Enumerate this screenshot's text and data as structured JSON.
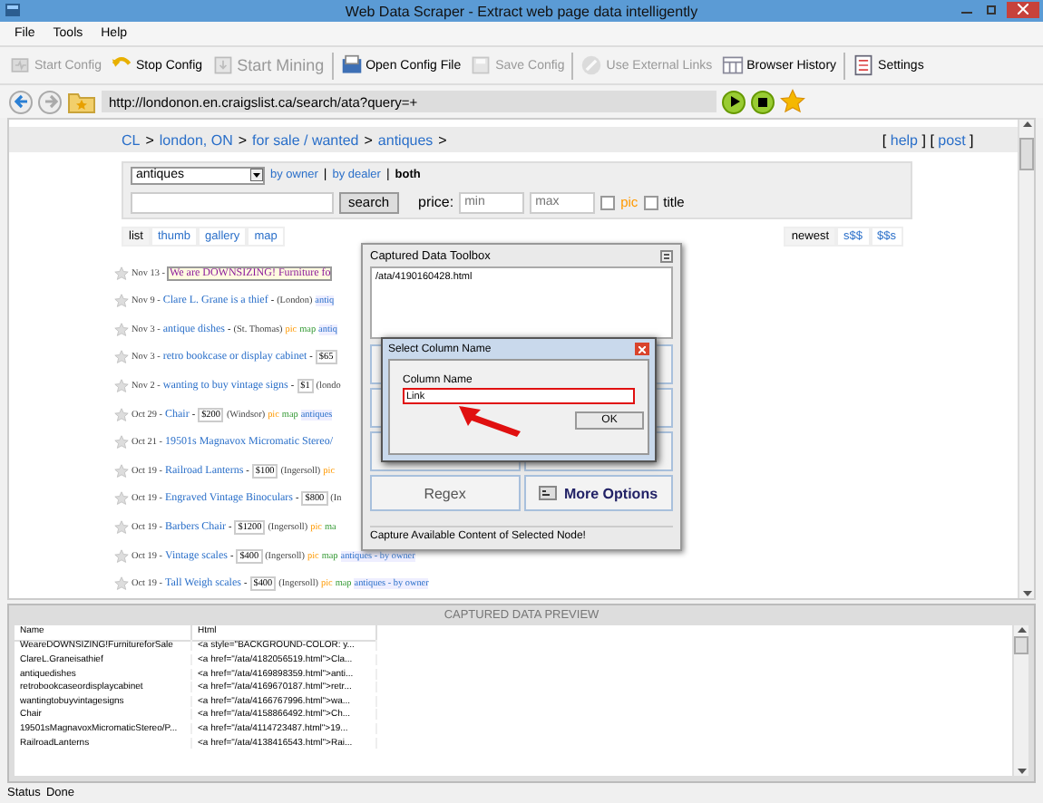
{
  "window": {
    "title": "Web Data Scraper -  Extract web page data intelligently"
  },
  "menu": [
    "File",
    "Tools",
    "Help"
  ],
  "toolbar": [
    {
      "label": "Start Config",
      "disabled": true
    },
    {
      "label": "Stop Config",
      "disabled": false
    },
    {
      "label": "Start Mining",
      "disabled": true
    },
    {
      "label": "Open Config File",
      "disabled": false
    },
    {
      "label": "Save Config",
      "disabled": true
    },
    {
      "label": "Use External Links",
      "disabled": true
    },
    {
      "label": "Browser History",
      "disabled": false
    },
    {
      "label": "Settings",
      "disabled": false
    }
  ],
  "address": {
    "url": "http://londonon.en.craigslist.ca/search/ata?query=+"
  },
  "breadcrumb": {
    "links": [
      "CL",
      "london, ON",
      "for sale / wanted",
      "antiques"
    ],
    "separator": ">",
    "help_links": [
      {
        "before": "[",
        "label": "help",
        "after": "]"
      },
      {
        "before": "[",
        "label": "post",
        "after": "]"
      }
    ]
  },
  "search": {
    "category": "antiques",
    "filters": [
      {
        "label": "by owner",
        "selected": false
      },
      {
        "label": "by dealer",
        "selected": false
      },
      {
        "label": "both",
        "selected": true
      }
    ],
    "filter_separator": "|",
    "button": "search",
    "price_label": "price:",
    "min_placeholder": "min",
    "max_placeholder": "max",
    "checkboxes": [
      {
        "label": "pic",
        "checked": false,
        "color": "#ff9900"
      },
      {
        "label": "title",
        "checked": false,
        "color": "#000000"
      }
    ]
  },
  "view_tabs": [
    {
      "label": "list",
      "selected": true
    },
    {
      "label": "thumb",
      "selected": false
    },
    {
      "label": "gallery",
      "selected": false
    },
    {
      "label": "map",
      "selected": false
    }
  ],
  "sort_tabs": [
    {
      "label": "newest",
      "selected": true
    },
    {
      "label": "s$$",
      "selected": false
    },
    {
      "label": "$$s",
      "selected": false
    }
  ],
  "listings": [
    {
      "highlighted": true,
      "parts": [
        {
          "kind": "date",
          "text": "Nov 13 -"
        },
        {
          "kind": "title",
          "text": "We are DOWNSIZING! Furniture fo"
        }
      ]
    },
    {
      "highlighted": false,
      "parts": [
        {
          "kind": "date",
          "text": "Nov 9 -"
        },
        {
          "kind": "title",
          "text": "Clare L. Grane is a thief"
        },
        {
          "kind": "text",
          "text": "-"
        },
        {
          "kind": "location",
          "text": "(London)"
        },
        {
          "kind": "tag",
          "text": "antiq"
        }
      ]
    },
    {
      "highlighted": false,
      "parts": [
        {
          "kind": "date",
          "text": "Nov 3 -"
        },
        {
          "kind": "title",
          "text": "antique dishes"
        },
        {
          "kind": "text",
          "text": "-"
        },
        {
          "kind": "location",
          "text": "(St. Thomas)"
        },
        {
          "kind": "pic",
          "text": "pic"
        },
        {
          "kind": "map",
          "text": "map"
        },
        {
          "kind": "tag",
          "text": "antiq"
        }
      ]
    },
    {
      "highlighted": false,
      "parts": [
        {
          "kind": "date",
          "text": "Nov 3 -"
        },
        {
          "kind": "title",
          "text": "retro bookcase or display cabinet"
        },
        {
          "kind": "text",
          "text": "-"
        },
        {
          "kind": "price",
          "text": "$65"
        }
      ]
    },
    {
      "highlighted": false,
      "parts": [
        {
          "kind": "date",
          "text": "Nov 2 -"
        },
        {
          "kind": "title",
          "text": "wanting to buy vintage signs"
        },
        {
          "kind": "text",
          "text": "-"
        },
        {
          "kind": "price",
          "text": "$1"
        },
        {
          "kind": "location",
          "text": "(londo"
        }
      ]
    },
    {
      "highlighted": false,
      "parts": [
        {
          "kind": "date",
          "text": "Oct 29 -"
        },
        {
          "kind": "title",
          "text": "Chair"
        },
        {
          "kind": "text",
          "text": "-"
        },
        {
          "kind": "price",
          "text": "$200"
        },
        {
          "kind": "location",
          "text": "(Windsor)"
        },
        {
          "kind": "pic",
          "text": "pic"
        },
        {
          "kind": "map",
          "text": "map"
        },
        {
          "kind": "tag",
          "text": "antiques"
        }
      ]
    },
    {
      "highlighted": false,
      "parts": [
        {
          "kind": "date",
          "text": "Oct 21 -"
        },
        {
          "kind": "title",
          "text": "19501s Magnavox Micromatic Stereo/"
        }
      ]
    },
    {
      "highlighted": false,
      "parts": [
        {
          "kind": "date",
          "text": "Oct 19 -"
        },
        {
          "kind": "title",
          "text": "Railroad Lanterns"
        },
        {
          "kind": "text",
          "text": "-"
        },
        {
          "kind": "price",
          "text": "$100"
        },
        {
          "kind": "location",
          "text": "(Ingersoll)"
        },
        {
          "kind": "pic",
          "text": "pic"
        }
      ]
    },
    {
      "highlighted": false,
      "parts": [
        {
          "kind": "date",
          "text": "Oct 19 -"
        },
        {
          "kind": "title",
          "text": "Engraved Vintage Binoculars"
        },
        {
          "kind": "text",
          "text": "-"
        },
        {
          "kind": "price",
          "text": "$800"
        },
        {
          "kind": "location",
          "text": "(In"
        }
      ]
    },
    {
      "highlighted": false,
      "parts": [
        {
          "kind": "date",
          "text": "Oct 19 -"
        },
        {
          "kind": "title",
          "text": "Barbers Chair"
        },
        {
          "kind": "text",
          "text": "-"
        },
        {
          "kind": "price",
          "text": "$1200"
        },
        {
          "kind": "location",
          "text": "(Ingersoll)"
        },
        {
          "kind": "pic",
          "text": "pic"
        },
        {
          "kind": "map",
          "text": "ma"
        }
      ]
    },
    {
      "highlighted": false,
      "parts": [
        {
          "kind": "date",
          "text": "Oct 19 -"
        },
        {
          "kind": "title",
          "text": "Vintage scales"
        },
        {
          "kind": "text",
          "text": "-"
        },
        {
          "kind": "price",
          "text": "$400"
        },
        {
          "kind": "location",
          "text": "(Ingersoll)"
        },
        {
          "kind": "pic",
          "text": "pic"
        },
        {
          "kind": "map",
          "text": "map"
        },
        {
          "kind": "tag",
          "text": "antiques - by owner"
        }
      ]
    },
    {
      "highlighted": false,
      "parts": [
        {
          "kind": "date",
          "text": "Oct 19 -"
        },
        {
          "kind": "title",
          "text": "Tall Weigh scales"
        },
        {
          "kind": "text",
          "text": "-"
        },
        {
          "kind": "price",
          "text": "$400"
        },
        {
          "kind": "location",
          "text": "(Ingersoll)"
        },
        {
          "kind": "pic",
          "text": "pic"
        },
        {
          "kind": "map",
          "text": "map"
        },
        {
          "kind": "tag",
          "text": "antiques - by owner"
        }
      ]
    }
  ],
  "toolbox": {
    "title": "Captured Data Toolbox",
    "content": "/ata/4190160428.html",
    "buttons": [
      "Regex",
      "More Options"
    ],
    "status": "Capture Available Content of Selected Node!"
  },
  "dialog": {
    "title": "Select Column Name",
    "label": "Column Name",
    "value": "Link",
    "button": "OK"
  },
  "preview": {
    "title": "CAPTURED DATA PREVIEW",
    "columns": [
      "Name",
      "Html"
    ],
    "rows": [
      [
        "WeareDOWNSIZING!FurnitureforSale",
        "<a style=\"BACKGROUND-COLOR: y..."
      ],
      [
        "ClareL.Graneisathief",
        "<a href=\"/ata/4182056519.html\">Cla..."
      ],
      [
        "antiquedishes",
        "<a href=\"/ata/4169898359.html\">anti..."
      ],
      [
        "retrobookcaseordisplaycabinet",
        "<a href=\"/ata/4169670187.html\">retr..."
      ],
      [
        "wantingtobuyvintagesigns",
        "<a href=\"/ata/4166767996.html\">wa..."
      ],
      [
        "Chair",
        "<a href=\"/ata/4158866492.html\">Ch..."
      ],
      [
        "19501sMagnavoxMicromaticStereo/P...",
        "<a href=\"/ata/4114723487.html\">19..."
      ],
      [
        "RailroadLanterns",
        "<a href=\"/ata/4138416543.html\">Rai..."
      ]
    ]
  },
  "status_bar": {
    "label": "Status",
    "value": "Done"
  }
}
